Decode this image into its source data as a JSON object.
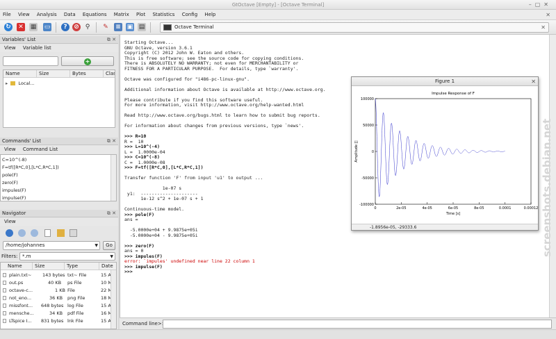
{
  "window": {
    "title": "GtOctave [Empty] - [Octave Terminal]"
  },
  "menu": [
    "File",
    "View",
    "Analysis",
    "Data",
    "Equations",
    "Matrix",
    "Plot",
    "Statistics",
    "Config",
    "Help"
  ],
  "terminal_tab": {
    "label": "Octave Terminal"
  },
  "variables_panel": {
    "title": "Variables' List",
    "tabs": [
      "View",
      "Variable list"
    ],
    "columns": [
      "Name",
      "Size",
      "Bytes",
      "Clas"
    ],
    "rows": [
      {
        "name": "Local..."
      }
    ]
  },
  "commands_panel": {
    "title": "Commands' List",
    "tabs": [
      "View",
      "Command List"
    ],
    "items": [
      "C=10^(-8)",
      "F=tf([R*C,0],[L*C,R*C,1])",
      "pole(F)",
      "zero(F)",
      "impules(F)",
      "impulse(F)"
    ]
  },
  "navigator": {
    "title": "Navigator",
    "tabs": [
      "View"
    ],
    "path": "/home/johannes",
    "go_label": "Go",
    "filter_label": "Filters:",
    "filter_value": "*.m",
    "columns": [
      "Name",
      "Size",
      "Type",
      "Date"
    ],
    "files": [
      {
        "name": "plain.txt~",
        "size": "143 bytes",
        "type": "txt~ File",
        "date": "15 A"
      },
      {
        "name": "out.ps",
        "size": "40 KB",
        "type": "ps File",
        "date": "10 M"
      },
      {
        "name": "octave-c...",
        "size": "1 KB",
        "type": "File",
        "date": "22 M"
      },
      {
        "name": "not_eno...",
        "size": "36 KB",
        "type": "png File",
        "date": "18 M"
      },
      {
        "name": "missfont...",
        "size": "648 bytes",
        "type": "log File",
        "date": "15 A"
      },
      {
        "name": "mensche...",
        "size": "34 KB",
        "type": "pdf File",
        "date": "16 M"
      },
      {
        "name": "LTspice I...",
        "size": "831 bytes",
        "type": "lnk File",
        "date": "15 A"
      }
    ]
  },
  "terminal": {
    "lines": [
      {
        "t": "Starting Octave...",
        "k": "out"
      },
      {
        "t": "GNU Octave, version 3.6.1",
        "k": "out"
      },
      {
        "t": "Copyright (C) 2012 John W. Eaton and others.",
        "k": "out"
      },
      {
        "t": "This is free software; see the source code for copying conditions.",
        "k": "out"
      },
      {
        "t": "There is ABSOLUTELY NO WARRANTY; not even for MERCHANTABILITY or",
        "k": "out"
      },
      {
        "t": "FITNESS FOR A PARTICULAR PURPOSE.  For details, type `warranty'.",
        "k": "out"
      },
      {
        "t": "",
        "k": "out"
      },
      {
        "t": "Octave was configured for \"i486-pc-linux-gnu\".",
        "k": "out"
      },
      {
        "t": "",
        "k": "out"
      },
      {
        "t": "Additional information about Octave is available at http://www.octave.org.",
        "k": "out"
      },
      {
        "t": "",
        "k": "out"
      },
      {
        "t": "Please contribute if you find this software useful.",
        "k": "out"
      },
      {
        "t": "For more information, visit http://www.octave.org/help-wanted.html",
        "k": "out"
      },
      {
        "t": "",
        "k": "out"
      },
      {
        "t": "Read http://www.octave.org/bugs.html to learn how to submit bug reports.",
        "k": "out"
      },
      {
        "t": "",
        "k": "out"
      },
      {
        "t": "For information about changes from previous versions, type `news'.",
        "k": "out"
      },
      {
        "t": "",
        "k": "out"
      },
      {
        "t": ">>> R=10",
        "k": "prompt"
      },
      {
        "t": "R =  10",
        "k": "out"
      },
      {
        "t": ">>> L=10^(-4)",
        "k": "prompt"
      },
      {
        "t": "L =  1.0000e-04",
        "k": "out"
      },
      {
        "t": ">>> C=10^(-8)",
        "k": "prompt"
      },
      {
        "t": "C =  1.0000e-08",
        "k": "out"
      },
      {
        "t": ">>> F=tf([R*C,0],[L*C,R*C,1])",
        "k": "prompt"
      },
      {
        "t": "",
        "k": "out"
      },
      {
        "t": "Transfer function 'F' from input 'u1' to output ...",
        "k": "out"
      },
      {
        "t": "",
        "k": "out"
      },
      {
        "t": "              1e-07 s",
        "k": "out"
      },
      {
        "t": " y1:  ---------------------",
        "k": "out"
      },
      {
        "t": "      1e-12 s^2 + 1e-07 s + 1",
        "k": "out"
      },
      {
        "t": "",
        "k": "out"
      },
      {
        "t": "Continuous-time model.",
        "k": "out"
      },
      {
        "t": ">>> pole(F)",
        "k": "prompt"
      },
      {
        "t": "ans =",
        "k": "out"
      },
      {
        "t": "",
        "k": "out"
      },
      {
        "t": "  -5.0000e+04 + 9.9875e+05i",
        "k": "out"
      },
      {
        "t": "  -5.0000e+04 - 9.9875e+05i",
        "k": "out"
      },
      {
        "t": "",
        "k": "out"
      },
      {
        "t": ">>> zero(F)",
        "k": "prompt"
      },
      {
        "t": "ans = 0",
        "k": "out"
      },
      {
        "t": ">>> impules(F)",
        "k": "prompt"
      },
      {
        "t": "error: `impules' undefined near line 22 column 1",
        "k": "error"
      },
      {
        "t": ">>> impulse(F)",
        "k": "prompt"
      },
      {
        "t": ">>>",
        "k": "prompt"
      }
    ]
  },
  "command_line": {
    "label": "Command line>>"
  },
  "figure": {
    "title": "Figure 1",
    "status": "-1.8956e-05, -29333.6",
    "chart_data": {
      "type": "line",
      "title": "Impulse Response of F",
      "xlabel": "Time [s]",
      "ylabel": "Amplitude [] ",
      "xlim": [
        0,
        0.00012
      ],
      "ylim": [
        -100000,
        100000
      ],
      "xticks": [
        "0",
        "2e-05",
        "4e-05",
        "6e-05",
        "8e-05",
        "0.0001",
        "0.00012"
      ],
      "yticks": [
        "100000",
        "50000",
        "0",
        "-50000",
        "-100000"
      ],
      "decay_rate": 50000,
      "angular_frequency": 998750,
      "sampled_to": 0.0001,
      "series_color": "#3333cc"
    }
  },
  "watermark": {
    "text": "screenshots.debian.net"
  }
}
